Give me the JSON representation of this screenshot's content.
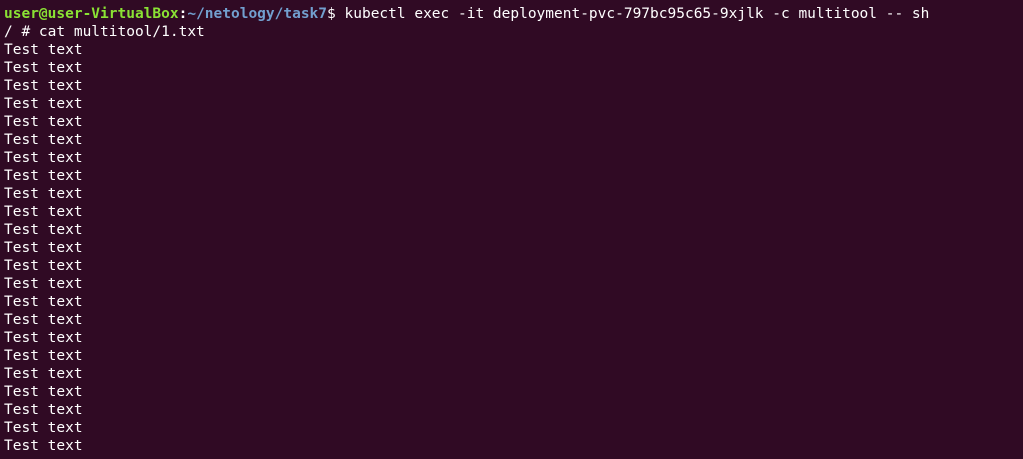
{
  "terminal": {
    "background": "#300a24",
    "prompt": {
      "user_host": "user@user-VirtualBox",
      "separator": ":",
      "path": "~/netology/task7",
      "symbol": "$ ",
      "command": "kubectl exec -it deployment-pvc-797bc95c65-9xjlk -c multitool -- sh",
      "user_color": "#8ae234",
      "path_color": "#729fcf"
    },
    "shell_line": "/ # cat multitool/1.txt",
    "output_line": "Test text",
    "output_count": 23
  }
}
